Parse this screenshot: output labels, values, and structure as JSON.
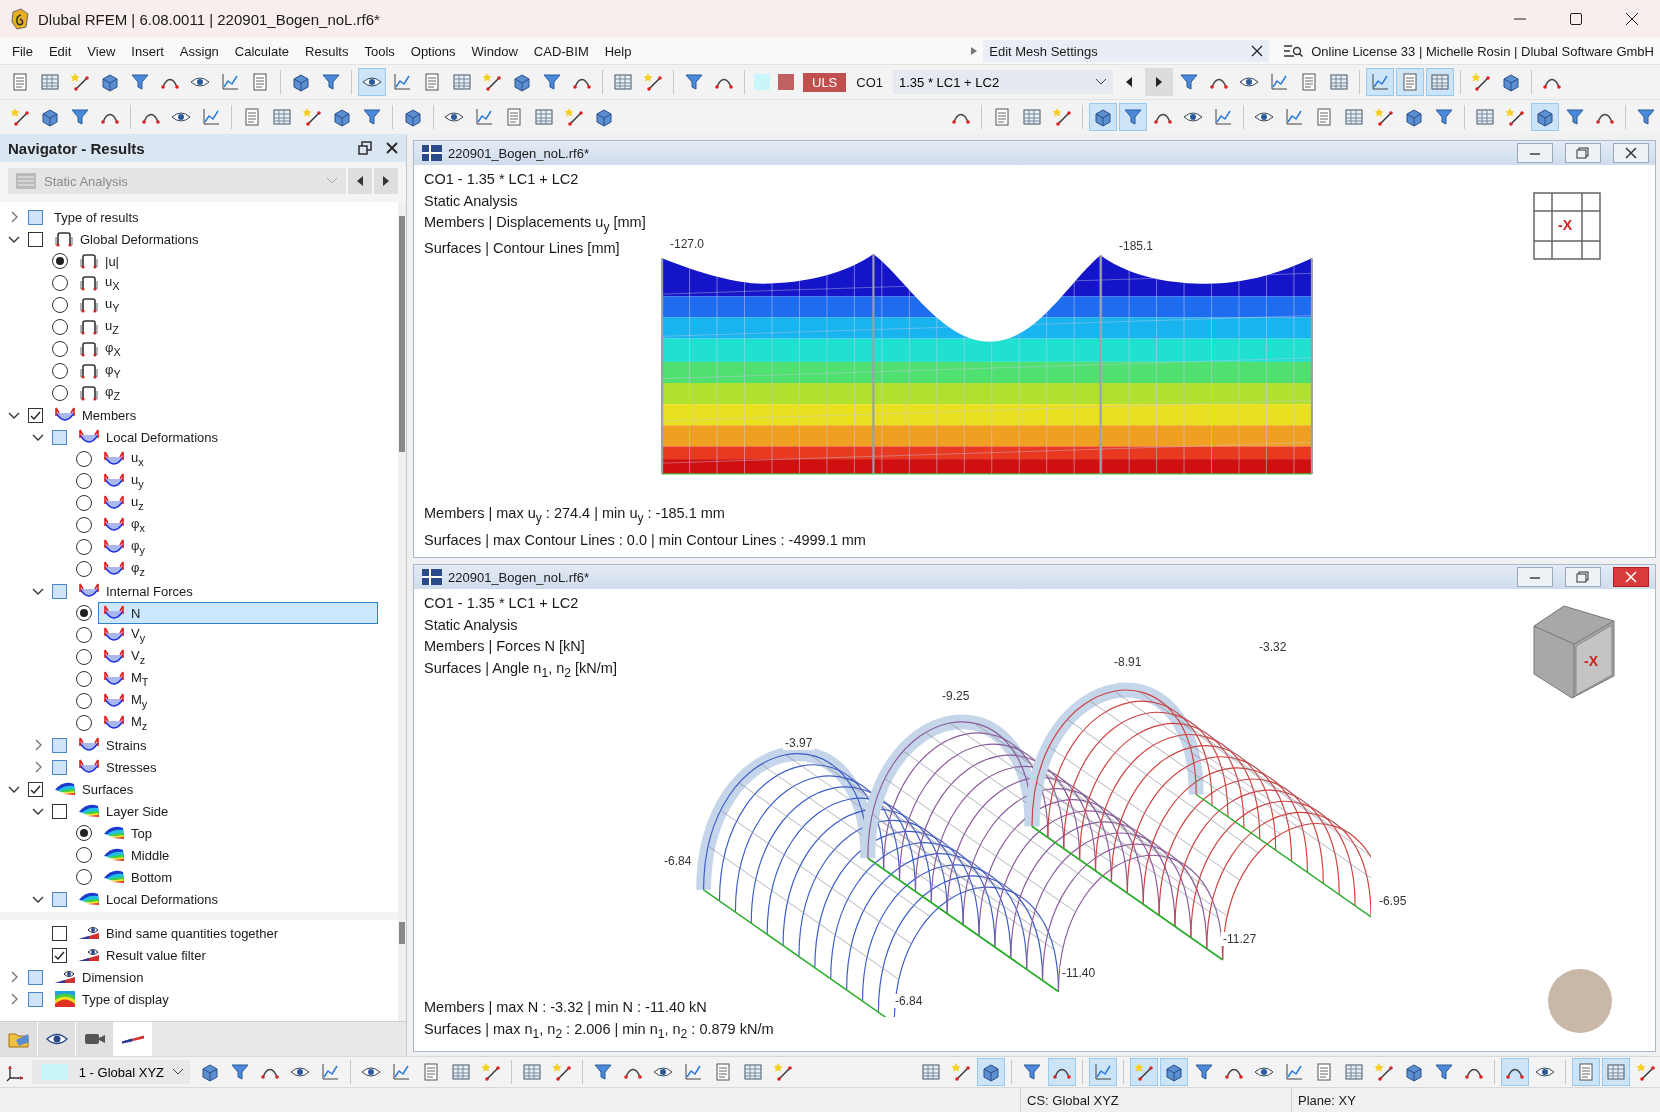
{
  "window": {
    "title": "Dlubal RFEM | 6.08.0011 | 220901_Bogen_noL.rf6*"
  },
  "menu": [
    "File",
    "Edit",
    "View",
    "Insert",
    "Assign",
    "Calculate",
    "Results",
    "Tools",
    "Options",
    "Window",
    "CAD-BIM",
    "Help"
  ],
  "command_search": {
    "value": "Edit Mesh Settings"
  },
  "license": "Online License 33 | Michelle Rosin | Dlubal Software GmbH",
  "toolbar_1": {
    "left": [
      {
        "pressed": [
          false,
          false,
          false,
          false,
          false,
          false,
          false,
          false,
          false
        ]
      },
      {
        "pressed": [
          false,
          false
        ]
      },
      {
        "pressed": [
          true,
          false,
          false,
          false,
          false,
          false,
          false,
          false
        ]
      },
      {
        "pressed": [
          false,
          false
        ]
      },
      {
        "pressed": [
          false,
          false
        ]
      }
    ],
    "load_combo": {
      "type": "ULS",
      "name": "CO1",
      "formula": "1.35 * LC1 + LC2"
    },
    "right": [
      {
        "pressed": [
          false,
          false,
          false,
          false,
          false,
          false
        ]
      },
      {
        "pressed": [
          true,
          true,
          true
        ]
      },
      {
        "pressed": [
          false,
          false
        ]
      },
      {
        "pressed": [
          false
        ]
      }
    ]
  },
  "toolbar_2": {
    "left": [
      {
        "pressed": [
          false,
          false,
          false,
          false
        ]
      },
      {
        "pressed": [
          false,
          false,
          false
        ]
      },
      {
        "pressed": [
          false,
          false,
          false,
          false,
          false
        ]
      },
      {
        "pressed": [
          false
        ]
      },
      {
        "pressed": [
          false,
          false,
          false,
          false,
          false,
          false
        ]
      }
    ],
    "right": [
      {
        "pressed": [
          false
        ]
      },
      {
        "pressed": [
          false,
          false,
          false
        ]
      },
      {
        "pressed": [
          true,
          true,
          false,
          false,
          false
        ]
      },
      {
        "pressed": [
          false,
          false,
          false,
          false,
          false,
          false,
          false
        ]
      },
      {
        "pressed": [
          false,
          false,
          true,
          false,
          false
        ]
      },
      {
        "pressed": [
          false
        ]
      }
    ]
  },
  "navigator": {
    "title": "Navigator - Results",
    "dropdown": "Static Analysis",
    "tree": [
      {
        "label": "Type of results",
        "kind": "checkbox",
        "checked": false,
        "mixed": true,
        "expanded": false,
        "selected": false
      },
      {
        "label": "Global Deformations",
        "kind": "checkbox",
        "checked": false,
        "mixed": false,
        "expanded": true,
        "selected": false,
        "children": [
          {
            "label": "|u|",
            "kind": "radio",
            "checked": true,
            "selected": false
          },
          {
            "label": "u$_{X}$",
            "kind": "radio",
            "checked": false,
            "selected": false
          },
          {
            "label": "u$_{Y}$",
            "kind": "radio",
            "checked": false,
            "selected": false
          },
          {
            "label": "u$_{Z}$",
            "kind": "radio",
            "checked": false,
            "selected": false
          },
          {
            "label": "φ$_{X}$",
            "kind": "radio",
            "checked": false,
            "selected": false
          },
          {
            "label": "φ$_{Y}$",
            "kind": "radio",
            "checked": false,
            "selected": false
          },
          {
            "label": "φ$_{Z}$",
            "kind": "radio",
            "checked": false,
            "selected": false
          }
        ]
      },
      {
        "label": "Members",
        "kind": "checkbox",
        "checked": true,
        "mixed": false,
        "expanded": true,
        "selected": false,
        "children": [
          {
            "label": "Local Deformations",
            "kind": "checkbox",
            "checked": false,
            "mixed": true,
            "expanded": true,
            "selected": false,
            "children": [
              {
                "label": "u$_{x}$",
                "kind": "radio",
                "checked": false,
                "selected": false
              },
              {
                "label": "u$_{y}$",
                "kind": "radio",
                "checked": false,
                "selected": false
              },
              {
                "label": "u$_{z}$",
                "kind": "radio",
                "checked": false,
                "selected": false
              },
              {
                "label": "φ$_{x}$",
                "kind": "radio",
                "checked": false,
                "selected": false
              },
              {
                "label": "φ$_{y}$",
                "kind": "radio",
                "checked": false,
                "selected": false
              },
              {
                "label": "φ$_{z}$",
                "kind": "radio",
                "checked": false,
                "selected": false
              }
            ]
          },
          {
            "label": "Internal Forces",
            "kind": "checkbox",
            "checked": false,
            "mixed": true,
            "expanded": true,
            "selected": false,
            "children": [
              {
                "label": "N",
                "kind": "radio",
                "checked": true,
                "selected": true
              },
              {
                "label": "V$_{y}$",
                "kind": "radio",
                "checked": false,
                "selected": false
              },
              {
                "label": "V$_{z}$",
                "kind": "radio",
                "checked": false,
                "selected": false
              },
              {
                "label": "M$_{T}$",
                "kind": "radio",
                "checked": false,
                "selected": false
              },
              {
                "label": "M$_{y}$",
                "kind": "radio",
                "checked": false,
                "selected": false
              },
              {
                "label": "M$_{z}$",
                "kind": "radio",
                "checked": false,
                "selected": false
              }
            ]
          },
          {
            "label": "Strains",
            "kind": "checkbox",
            "checked": false,
            "mixed": true,
            "expanded": false,
            "selected": false
          },
          {
            "label": "Stresses",
            "kind": "checkbox",
            "checked": false,
            "mixed": true,
            "expanded": false,
            "selected": false
          }
        ]
      },
      {
        "label": "Surfaces",
        "kind": "checkbox",
        "checked": true,
        "mixed": false,
        "expanded": true,
        "selected": false,
        "children": [
          {
            "label": "Layer Side",
            "kind": "checkbox",
            "checked": false,
            "mixed": false,
            "expanded": true,
            "selected": false,
            "children": [
              {
                "label": "Top",
                "kind": "radio",
                "checked": true,
                "selected": false
              },
              {
                "label": "Middle",
                "kind": "radio",
                "checked": false,
                "selected": false
              },
              {
                "label": "Bottom",
                "kind": "radio",
                "checked": false,
                "selected": false
              }
            ]
          },
          {
            "label": "Local Deformations",
            "kind": "checkbox",
            "checked": false,
            "mixed": true,
            "expanded": true,
            "selected": false
          }
        ]
      }
    ],
    "settings": [
      {
        "label": "Bind same quantities together",
        "kind": "checkbox",
        "checked": false,
        "mixed": false,
        "selected": false
      },
      {
        "label": "Result value filter",
        "kind": "checkbox",
        "checked": true,
        "mixed": false,
        "selected": false
      },
      {
        "label": "Dimension",
        "kind": "checkbox",
        "checked": false,
        "mixed": true,
        "expanded": false,
        "selected": false
      },
      {
        "label": "Type of display",
        "kind": "checkbox",
        "checked": false,
        "mixed": true,
        "expanded": false,
        "selected": false
      }
    ],
    "tabs": [
      {
        "selected": false
      },
      {
        "selected": false
      },
      {
        "selected": false
      },
      {
        "selected": true
      }
    ]
  },
  "views": [
    {
      "kind": "contour",
      "title": "220901_Bogen_noL.rf6*",
      "active": false,
      "info": [
        "CO1 - 1.35 * LC1 + LC2",
        "Static Analysis",
        "Members | Displacements u$_{y}$ [mm]",
        "Surfaces | Contour Lines  [mm]"
      ],
      "labels": [
        "-127.0",
        "-185.1"
      ],
      "axis_label": "-X",
      "summary": [
        "Members | max u$_{y}$ : 274.4 | min u$_{y}$ : -185.1 mm",
        "Surfaces | max Contour Lines : 0.0 | min Contour Lines : -4999.1 mm"
      ]
    },
    {
      "kind": "mesh",
      "title": "220901_Bogen_noL.rf6*",
      "active": true,
      "info": [
        "CO1 - 1.35 * LC1 + LC2",
        "Static Analysis",
        "Members | Forces N [kN]",
        "Surfaces | Angle n$_{1}$, n$_{2}$ [kN/m]"
      ],
      "labels": [
        "-3.97",
        "-9.25",
        "-8.91",
        "-3.32",
        "-6.84",
        "-6.95",
        "-11.27",
        "-11.40",
        "-6.84"
      ],
      "axis_label": "-X",
      "summary": [
        "Members | max N : -3.32 | min N : -11.40 kN",
        "Surfaces | max n$_{1}$, n$_{2}$ : 2.006 | min n$_{1}$, n$_{2}$ : 0.879 kN/m"
      ]
    }
  ],
  "bottom_toolbar": {
    "coordinate_system": "1 - Global XYZ",
    "left": [
      {
        "pressed": [
          false,
          false,
          false,
          false,
          false
        ]
      },
      {
        "pressed": [
          false,
          false,
          false,
          false,
          false
        ]
      },
      {
        "pressed": [
          false,
          false
        ]
      },
      {
        "pressed": [
          false,
          false,
          false,
          false,
          false,
          false,
          false
        ]
      }
    ],
    "right": [
      {
        "pressed": [
          false,
          false,
          true
        ]
      },
      {
        "pressed": [
          false,
          true
        ]
      },
      {
        "pressed": [
          true
        ]
      },
      {
        "pressed": [
          true,
          true,
          false,
          false,
          false,
          false,
          false,
          false,
          false,
          false,
          false,
          false
        ]
      },
      {
        "pressed": [
          true,
          false
        ]
      },
      {
        "pressed": [
          true,
          true,
          false
        ]
      }
    ]
  },
  "status_bar": [
    "CS: Global XYZ",
    "Plane: XY"
  ]
}
